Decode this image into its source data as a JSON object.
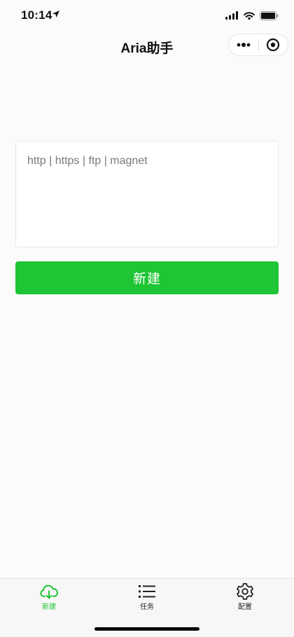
{
  "status_bar": {
    "time": "10:14"
  },
  "nav": {
    "title": "Aria助手"
  },
  "form": {
    "url_placeholder": "http | https | ftp | magnet",
    "url_value": "",
    "create_label": "新建"
  },
  "tabs": [
    {
      "label": "新建",
      "icon": "cloud-download-icon",
      "active": true
    },
    {
      "label": "任务",
      "icon": "list-icon",
      "active": false
    },
    {
      "label": "配置",
      "icon": "gear-icon",
      "active": false
    }
  ],
  "colors": {
    "accent": "#1ec534",
    "background": "#fbfbfb",
    "tabbar_bg": "#f7f7f7"
  }
}
